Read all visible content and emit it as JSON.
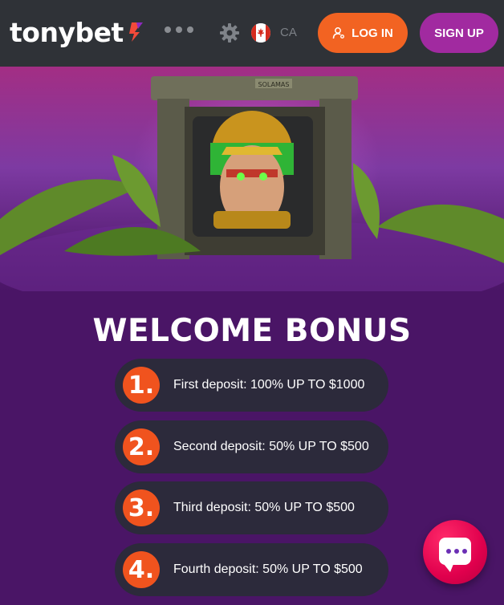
{
  "header": {
    "logo_text": "tonybet",
    "more_icon": "more-dots-icon",
    "settings_icon": "gear-icon",
    "flag_icon": "canada-flag-icon",
    "region": "CA",
    "login_label": "LOG IN",
    "login_icon": "user-key-icon",
    "signup_label": "SIGN UP"
  },
  "hero": {
    "sign_text": "SOLAMAS",
    "image": "aztec-warrior-slot-symbol"
  },
  "bonus": {
    "title": "WELCOME BONUS",
    "items": [
      {
        "number": "1.",
        "text": "First deposit: 100% UP TO $1000"
      },
      {
        "number": "2.",
        "text": "Second deposit: 50% UP TO $500"
      },
      {
        "number": "3.",
        "text": "Third deposit: 50% UP TO $500"
      },
      {
        "number": "4.",
        "text": "Fourth deposit: 50% UP TO $500"
      }
    ]
  },
  "chat": {
    "icon": "chat-bubble-icon"
  },
  "colors": {
    "header_bg": "#2f3237",
    "login_orange": "#f26322",
    "signup_purple": "#a12aa0",
    "page_purple": "#4a1566",
    "number_orange": "#f0531e",
    "row_bg": "#2c2a3b",
    "chat_red": "#e0004d"
  }
}
